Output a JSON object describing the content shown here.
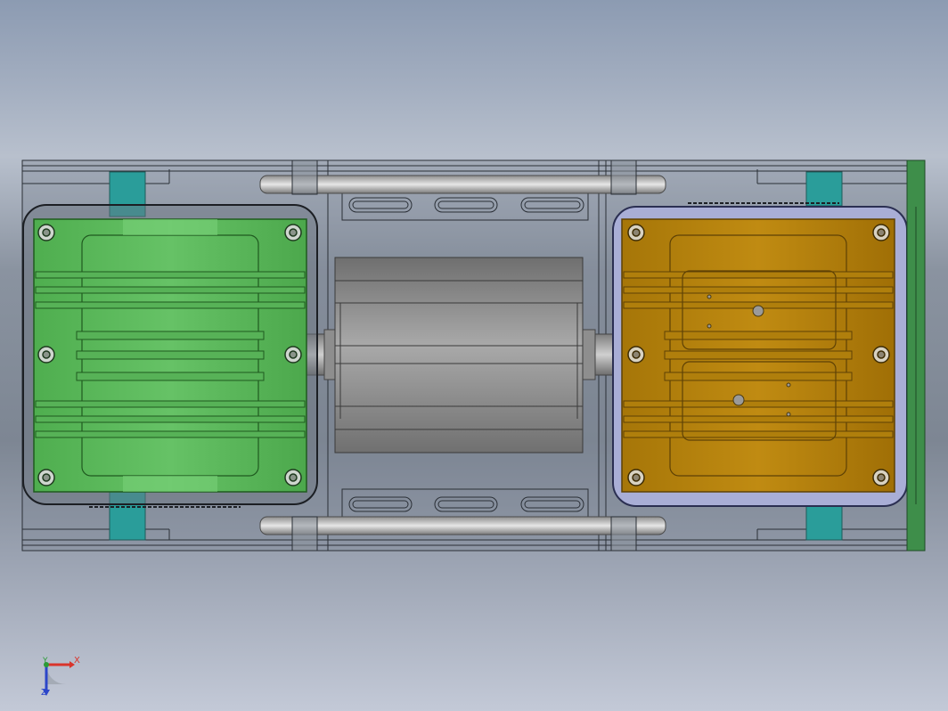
{
  "colors": {
    "green_plate": "#5cb85c",
    "green_plate_dark": "#2e7d2e",
    "orange_plate": "#b8860b",
    "orange_plate_dark": "#6b4a05",
    "teal_clip": "#2a9d9a",
    "motor_body": "#8f8f8f",
    "rod": "#c8c8c8",
    "side_panel": "#3e8e4a",
    "axis_x": "#d9342b",
    "axis_y": "#2b9b36",
    "axis_z": "#2c46c9"
  },
  "triad": {
    "x_label": "X",
    "y_label": "Y",
    "z_label": "Z"
  }
}
